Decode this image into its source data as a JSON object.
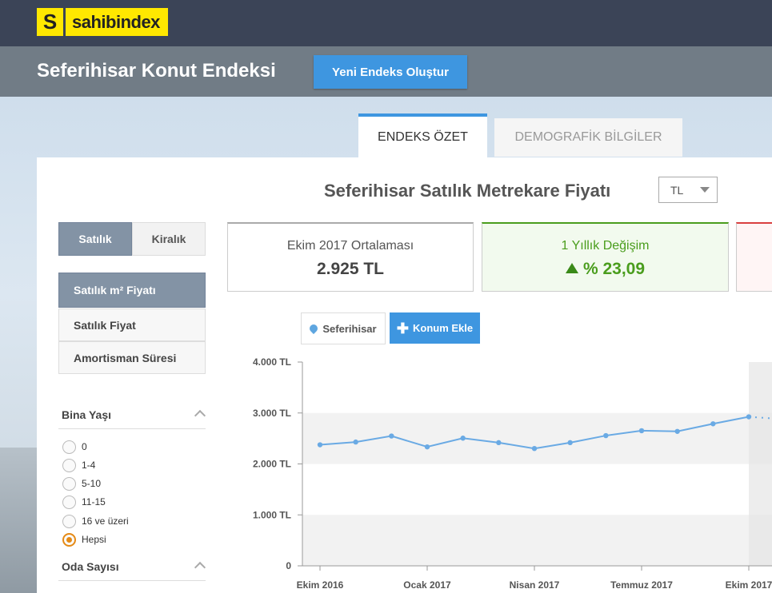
{
  "brand": {
    "logo_letter": "S",
    "logo_text": "sahibindex"
  },
  "header": {
    "title": "Seferihisar Konut Endeksi",
    "new_index_button": "Yeni Endeks Oluştur"
  },
  "tabs": {
    "active": "ENDEKS ÖZET",
    "inactive": "DEMOGRAFİK BİLGİLER"
  },
  "chart_header": {
    "title": "Seferihisar Satılık Metrekare Fiyatı",
    "currency": "TL"
  },
  "sidebar": {
    "segments": [
      "Satılık",
      "Kiralık"
    ],
    "menu": [
      "Satılık m² Fiyatı",
      "Satılık Fiyat",
      "Amortisman Süresi"
    ],
    "filters": [
      {
        "title": "Bina Yaşı",
        "options": [
          "0",
          "1-4",
          "5-10",
          "11-15",
          "16 ve üzeri",
          "Hepsi"
        ],
        "selected": "Hepsi"
      },
      {
        "title": "Oda Sayısı"
      }
    ]
  },
  "stats": {
    "average_label": "Ekim 2017 Ortalaması",
    "average_value": "2.925 TL",
    "change_label": "1 Yıllık Değişim",
    "change_value": "% 23,09"
  },
  "location": {
    "chip": "Seferihisar",
    "add_button": "Konum Ekle"
  },
  "colors": {
    "accent": "#3e96e0",
    "positive": "#4a9d1d",
    "line": "#6aaae4",
    "header": "#3b4457"
  },
  "chart_data": {
    "type": "line",
    "x": [
      "Ekim 2016",
      "Kasım 2016",
      "Aralık 2016",
      "Ocak 2017",
      "Şubat 2017",
      "Mart 2017",
      "Nisan 2017",
      "Mayıs 2017",
      "Haziran 2017",
      "Temmuz 2017",
      "Ağustos 2017",
      "Eylül 2017",
      "Ekim 2017"
    ],
    "x_tick_labels": [
      "Ekim 2016",
      "Ocak 2017",
      "Nisan 2017",
      "Temmuz 2017",
      "Ekim 2017"
    ],
    "values": [
      2376,
      2430,
      2548,
      2335,
      2506,
      2418,
      2303,
      2418,
      2556,
      2652,
      2639,
      2788,
      2925
    ],
    "y_ticks": [
      "4.000 TL",
      "3.000 TL",
      "2.000 TL",
      "1.000 TL",
      "0"
    ],
    "ylim": [
      0,
      4000
    ]
  }
}
